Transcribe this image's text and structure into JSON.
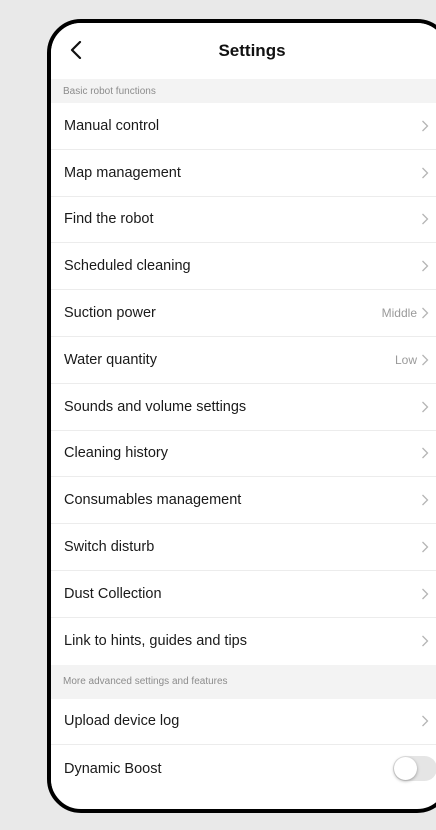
{
  "header": {
    "title": "Settings"
  },
  "sections": [
    {
      "title": "Basic robot functions",
      "items": [
        {
          "label": "Manual control",
          "value": ""
        },
        {
          "label": "Map management",
          "value": ""
        },
        {
          "label": "Find the robot",
          "value": ""
        },
        {
          "label": "Scheduled cleaning",
          "value": ""
        },
        {
          "label": "Suction power",
          "value": "Middle"
        },
        {
          "label": "Water quantity",
          "value": "Low"
        },
        {
          "label": "Sounds and volume settings",
          "value": ""
        },
        {
          "label": "Cleaning history",
          "value": ""
        },
        {
          "label": "Consumables management",
          "value": ""
        },
        {
          "label": "Switch disturb",
          "value": ""
        },
        {
          "label": "Dust Collection",
          "value": ""
        },
        {
          "label": "Link to hints, guides and tips",
          "value": ""
        }
      ]
    },
    {
      "title": "More advanced settings and features",
      "items": [
        {
          "label": "Upload device log",
          "value": ""
        },
        {
          "label": "Dynamic Boost",
          "toggle": false
        }
      ]
    }
  ],
  "icons": {
    "back": "chevron-left-icon",
    "row": "chevron-right-icon"
  },
  "colors": {
    "frame": "#000000",
    "background": "#e9e9e9",
    "section_header_bg": "#f3f3f3"
  }
}
